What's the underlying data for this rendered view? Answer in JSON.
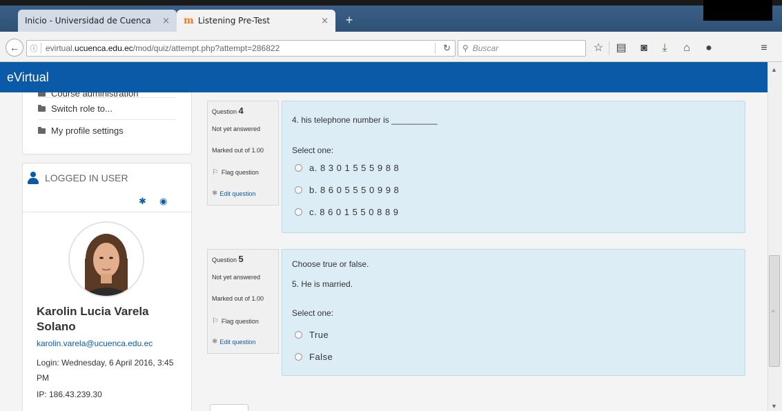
{
  "browser": {
    "tabs": [
      {
        "title": "Inicio - Universidad de Cuenca",
        "close": "×"
      },
      {
        "title": "Listening Pre-Test",
        "close": "×",
        "favicon": "m"
      }
    ],
    "new_tab": "+",
    "url_prefix": "evirtual.",
    "url_domain": "ucuenca.edu.ec",
    "url_path": "/mod/quiz/attempt.php?attempt=286822",
    "search_placeholder": "Buscar",
    "icons": [
      "back-icon",
      "info-icon",
      "reload-icon",
      "search-icon",
      "star-icon",
      "reading-list-icon",
      "pocket-icon",
      "download-icon",
      "home-icon",
      "chat-icon",
      "menu-icon"
    ]
  },
  "header": {
    "title": "eVirtual"
  },
  "sidebar": {
    "admin_items": [
      "Course administration",
      "Switch role to...",
      "My profile settings"
    ],
    "user_block": {
      "title": "LOGGED IN USER",
      "name": "Karolin Lucia Varela Solano",
      "email": "karolin.varela@ucuenca.edu.ec",
      "login": "Login: Wednesday, 6 April 2016, 3:45 PM",
      "ip": "IP: 186.43.239.30"
    }
  },
  "questions": [
    {
      "label": "Question",
      "number": "4",
      "status": "Not yet answered",
      "marked": "Marked out of 1.00",
      "flag": "Flag question",
      "edit": "Edit question",
      "prompt": "",
      "text": "4. his telephone number is __________",
      "select": "Select one:",
      "options": [
        "a. 8 3 0 1 5 5 5 9 8 8",
        "b. 8 6 0 5 5 5 0 9 9 8",
        "c. 8 6 0 1 5 5 0 8 8 9"
      ]
    },
    {
      "label": "Question",
      "number": "5",
      "status": "Not yet answered",
      "marked": "Marked out of 1.00",
      "flag": "Flag question",
      "edit": "Edit question",
      "prompt": "Choose true or false.",
      "text": "5. He is married.",
      "select": "Select one:",
      "options": [
        "True",
        "False"
      ]
    }
  ],
  "colors": {
    "header": "#0b5aa8",
    "question_bg": "#dcedf6",
    "link": "#0b5aa8"
  }
}
